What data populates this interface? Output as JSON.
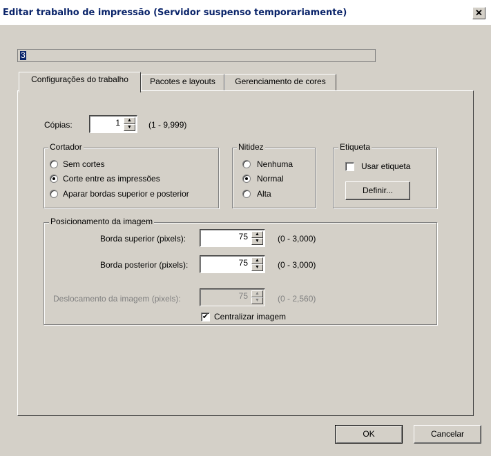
{
  "window": {
    "title": "Editar trabalho de impressão (Servidor suspenso temporariamente)",
    "close_symbol": "✕"
  },
  "job_name": "3",
  "tabs": [
    {
      "label": "Configurações do trabalho",
      "active": true
    },
    {
      "label": "Pacotes e layouts",
      "active": false
    },
    {
      "label": "Gerenciamento de cores",
      "active": false
    }
  ],
  "copies": {
    "label": "Cópias:",
    "value": "1",
    "range": "(1 - 9,999)"
  },
  "cutter": {
    "legend": "Cortador",
    "options": [
      {
        "label": "Sem cortes",
        "selected": false
      },
      {
        "label": "Corte entre as impressões",
        "selected": true
      },
      {
        "label": "Aparar bordas superior e posterior",
        "selected": false
      }
    ]
  },
  "sharpness": {
    "legend": "Nitidez",
    "options": [
      {
        "label": "Nenhuma",
        "selected": false
      },
      {
        "label": "Normal",
        "selected": true
      },
      {
        "label": "Alta",
        "selected": false
      }
    ]
  },
  "label_group": {
    "legend": "Etiqueta",
    "use_label": "Usar etiqueta",
    "use_label_checked": false,
    "define_button": "Definir..."
  },
  "positioning": {
    "legend": "Posicionamento da imagem",
    "top_edge": {
      "label": "Borda superior (pixels):",
      "value": "75",
      "range": "(0 - 3,000)",
      "enabled": true
    },
    "trail_edge": {
      "label": "Borda posterior (pixels):",
      "value": "75",
      "range": "(0 - 3,000)",
      "enabled": true
    },
    "offset": {
      "label": "Deslocamento da imagem (pixels):",
      "value": "75",
      "range": "(0 - 2,560)",
      "enabled": false
    },
    "center_label": "Centralizar imagem",
    "center_checked": true,
    "check_mark": "✔"
  },
  "footer": {
    "ok": "OK",
    "cancel": "Cancelar"
  },
  "icons": {
    "spin_up": "▲",
    "spin_down": "▼"
  }
}
